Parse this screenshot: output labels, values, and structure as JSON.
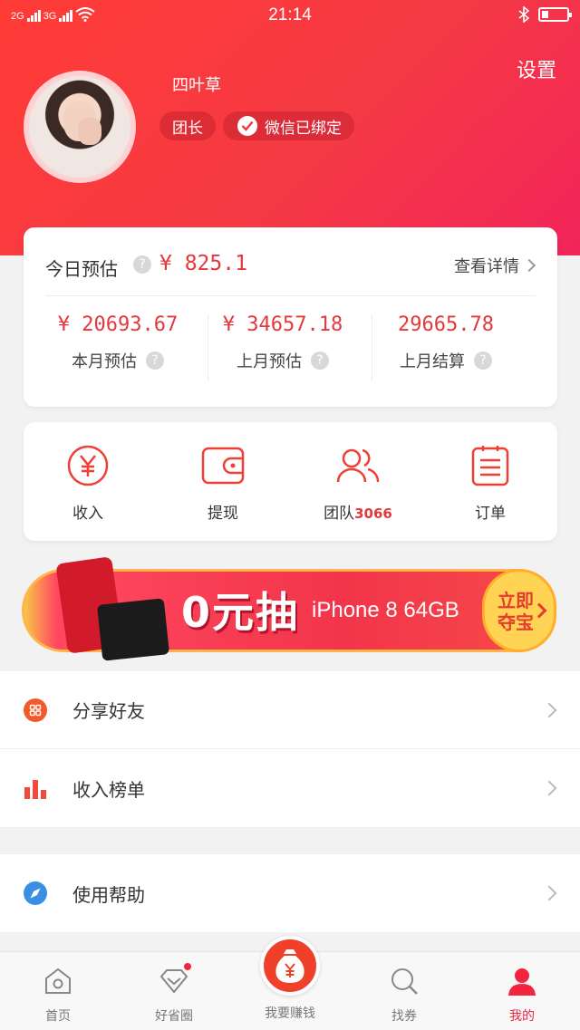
{
  "status_bar": {
    "time": "21:14",
    "network_1": "2G",
    "network_2": "3G"
  },
  "header": {
    "settings_label": "设置",
    "username": "四叶草",
    "role_badge": "团长",
    "wechat_badge": "微信已绑定"
  },
  "earnings": {
    "today_label": "今日预估",
    "today_value": "¥ 825.1",
    "detail_link": "查看详情",
    "stats": [
      {
        "value": "¥ 20693.67",
        "label": "本月预估"
      },
      {
        "value": "¥ 34657.18",
        "label": "上月预估"
      },
      {
        "value": "29665.78",
        "label": "上月结算"
      }
    ],
    "help_glyph": "?"
  },
  "shortcuts": [
    {
      "label": "收入",
      "icon": "yen-circle-icon"
    },
    {
      "label": "提现",
      "icon": "wallet-icon"
    },
    {
      "label": "团队",
      "count": "3066",
      "icon": "team-icon"
    },
    {
      "label": "订单",
      "icon": "order-list-icon"
    }
  ],
  "banner": {
    "headline": "0元抽",
    "product": "iPhone 8 64GB",
    "cta_line1": "立即",
    "cta_line2": "夺宝"
  },
  "menu": [
    {
      "label": "分享好友",
      "icon": "share-grid-icon"
    },
    {
      "label": "收入榜单",
      "icon": "bar-chart-icon"
    },
    {
      "label": "使用帮助",
      "icon": "compass-icon"
    }
  ],
  "tabbar": {
    "items": [
      {
        "label": "首页",
        "icon": "home-icon"
      },
      {
        "label": "好省圈",
        "icon": "diamond-icon"
      },
      {
        "label": "我要赚钱",
        "icon": "money-bag-icon"
      },
      {
        "label": "找券",
        "icon": "search-icon"
      },
      {
        "label": "我的",
        "icon": "person-icon"
      }
    ]
  },
  "colors": {
    "brand_red": "#f2243f",
    "price_red": "#e4393c",
    "cta_yellow": "#ffd454"
  }
}
